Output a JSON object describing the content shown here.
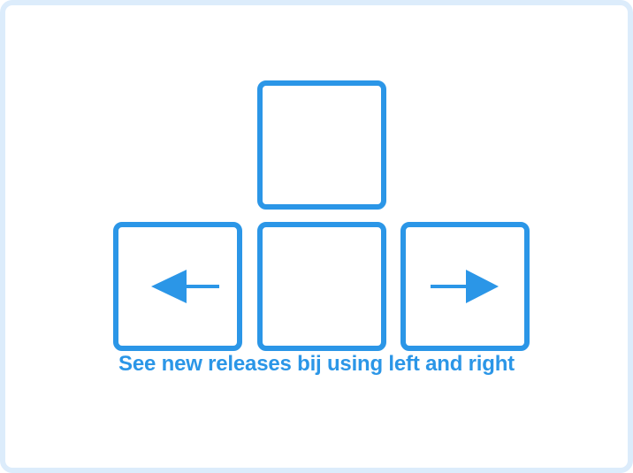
{
  "hint": {
    "text": "See new releases bij using left and right"
  },
  "keys": [
    {
      "name": "up",
      "icon": null
    },
    {
      "name": "left",
      "icon": "left-arrow-icon"
    },
    {
      "name": "down",
      "icon": null
    },
    {
      "name": "right",
      "icon": "right-arrow-icon"
    }
  ],
  "colors": {
    "accent": "#2b96e7",
    "frame_border": "#dcecfb",
    "background": "#ffffff"
  }
}
